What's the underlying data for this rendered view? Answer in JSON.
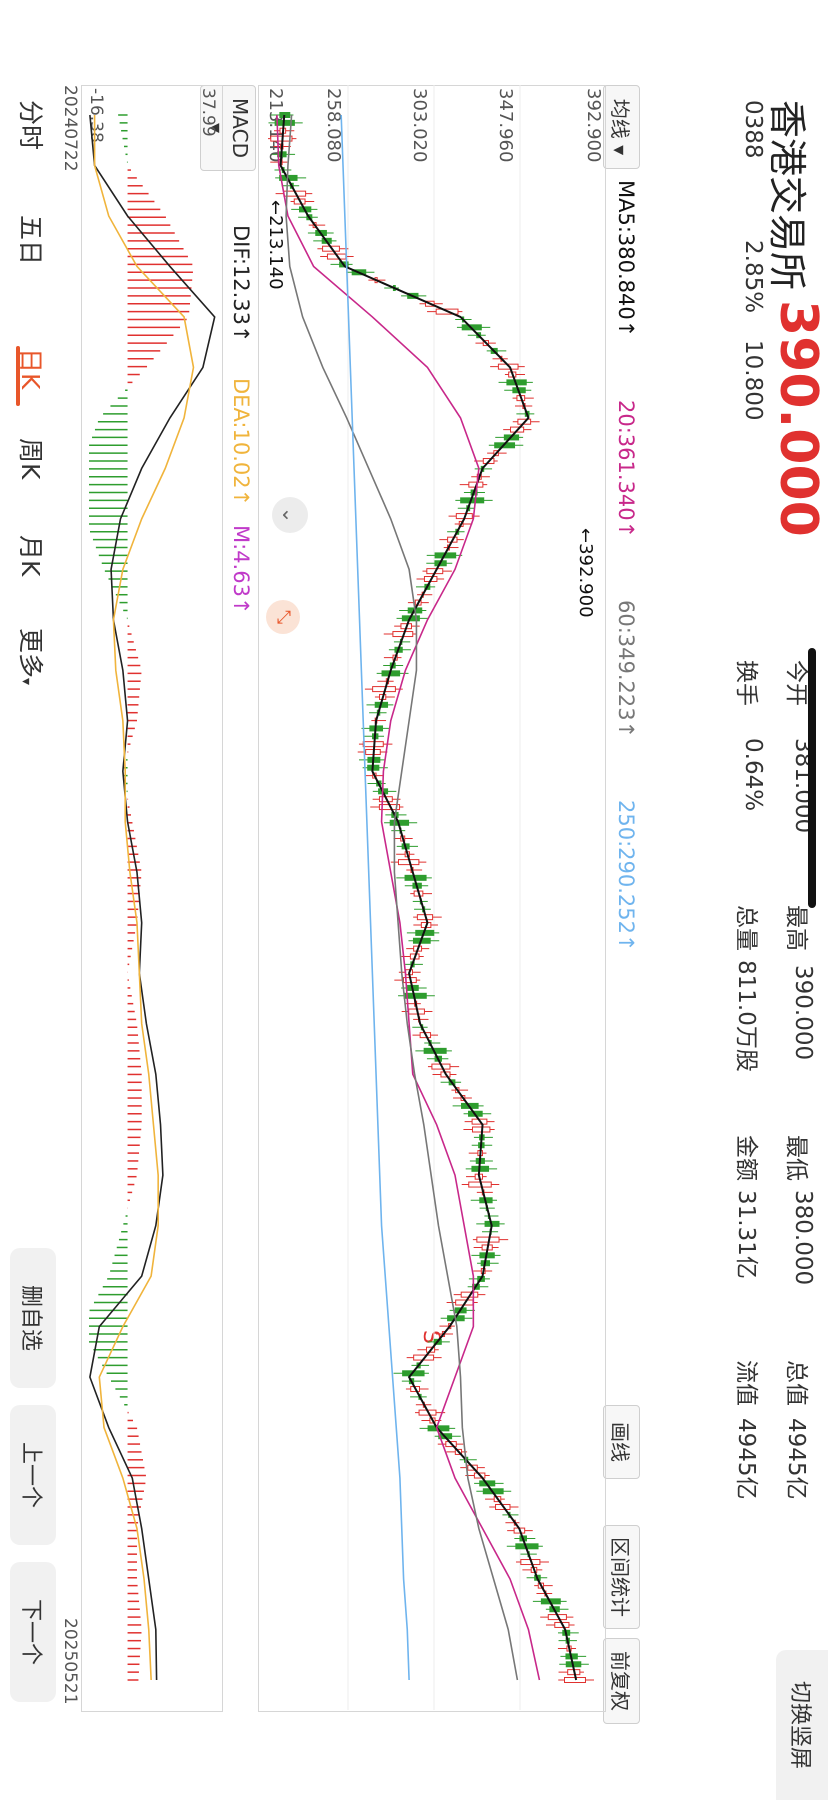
{
  "header": {
    "name": "香港交易所",
    "price": "390.000",
    "code": "0388",
    "change_pct": "2.85%",
    "change_amt": "10.800",
    "open_label": "今开",
    "open_value": "381.000",
    "turnover_label": "换手",
    "turnover_value": "0.64%",
    "high_label": "最高",
    "high_value": "390.000",
    "volume_label": "总量",
    "volume_value": "811.0万股",
    "low_label": "最低",
    "low_value": "380.000",
    "amount_label": "金额",
    "amount_value": "31.31亿",
    "mcap_label": "总值",
    "mcap_value": "4945亿",
    "float_label": "流值",
    "float_value": "4945亿",
    "switch_button": "切换竖屏"
  },
  "chart_toolbar": {
    "ma_select": "均线",
    "ma5": "MA5:380.840↑",
    "ma20": "20:361.340↑",
    "ma60": "60:349.223↑",
    "ma250": "250:290.252↑",
    "draw_button": "画线",
    "range_stats_button": "区间统计",
    "adjust_button": "前复权"
  },
  "price_axis": {
    "ticks": [
      "392.900",
      "347.960",
      "303.020",
      "258.080",
      "213.140"
    ],
    "max_marker": "←392.900",
    "min_marker": "←213.140"
  },
  "indicator": {
    "select": "MACD",
    "dif": "DIF:12.33↑",
    "dea": "DEA:10.02↑",
    "m": "M:4.63↑",
    "top_value": "37.99",
    "bottom_value": "-16.38"
  },
  "dates": {
    "start": "20240722",
    "end": "20250521"
  },
  "signal_marker": "S",
  "tabs": [
    "分时",
    "五日",
    "日K",
    "周K",
    "月K",
    "更多"
  ],
  "active_tab": "日K",
  "side_buttons": {
    "remove_watch": "删自选",
    "prev": "上一个",
    "next": "下一个"
  },
  "colors": {
    "up": "#e0312f",
    "down": "#2e9d2e",
    "ma5": "#111111",
    "ma20": "#c8288a",
    "ma60": "#777777",
    "ma250": "#6fb4ee",
    "dea": "#f0b43c",
    "tab_active": "#e8562a"
  },
  "chart_data": {
    "type": "line",
    "x_range": [
      "20240722",
      "20250521"
    ],
    "ylim": [
      213.14,
      392.9
    ],
    "series": [
      {
        "name": "MA5",
        "values": [
          222,
          220,
          235,
          255,
          318,
          345,
          355,
          330,
          320,
          305,
          290,
          280,
          272,
          270,
          284,
          292,
          300,
          290,
          296,
          310,
          330,
          328,
          335,
          330,
          312,
          290,
          305,
          330,
          350,
          360,
          375,
          381
        ]
      },
      {
        "name": "20",
        "values": [
          218,
          219,
          224,
          238,
          270,
          300,
          318,
          328,
          325,
          315,
          300,
          288,
          280,
          276,
          275,
          280,
          285,
          288,
          290,
          292,
          305,
          315,
          320,
          325,
          325,
          315,
          305,
          315,
          330,
          345,
          355,
          361
        ]
      },
      {
        "name": "60",
        "values": [
          226,
          224,
          223,
          225,
          232,
          243,
          256,
          268,
          280,
          290,
          294,
          294,
          290,
          286,
          282,
          282,
          284,
          286,
          289,
          293,
          298,
          302,
          306,
          311,
          316,
          318,
          319,
          322,
          328,
          336,
          344,
          349
        ]
      },
      {
        "name": "250",
        "values": [
          253,
          254,
          255,
          256,
          257,
          258,
          259,
          260,
          261,
          262,
          263,
          264,
          265,
          266,
          267,
          268,
          269,
          270,
          271,
          272,
          273,
          274,
          275,
          277,
          279,
          281,
          283,
          285,
          286,
          287,
          289,
          290
        ]
      }
    ],
    "macd": {
      "ylim": [
        -16.38,
        37.99
      ],
      "dif": [
        -16,
        -14,
        0,
        18,
        37,
        32,
        18,
        6,
        -3,
        -7,
        -6,
        -2,
        0,
        -2,
        0,
        4,
        6,
        5,
        8,
        12,
        14,
        15,
        12,
        6,
        -12,
        -16,
        -8,
        2,
        6,
        9,
        12,
        12.33
      ],
      "dea": [
        -14,
        -14,
        -8,
        4,
        24,
        28,
        24,
        16,
        6,
        -2,
        -6,
        -5,
        -2,
        -1,
        -1,
        1,
        4,
        5,
        6,
        9,
        11,
        13,
        13,
        10,
        -2,
        -12,
        -10,
        -2,
        4,
        7,
        9,
        10.02
      ]
    }
  }
}
